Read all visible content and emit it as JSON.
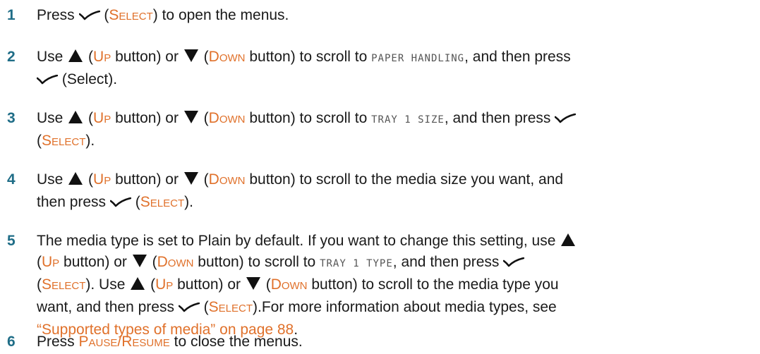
{
  "colors": {
    "step_number": "#1f6d87",
    "accent": "#e0712b"
  },
  "icons": {
    "check": "check-icon",
    "up": "up-arrow-icon",
    "down": "down-arrow-icon"
  },
  "common": {
    "press": "Press",
    "use": "Use",
    "open_paren": "(",
    "close_paren_dot": ").",
    "close_paren": ")",
    "or": "or",
    "button_or": "button) or",
    "button_scroll": "button) to scroll to",
    "and_then_press": ", and then press",
    "select_s": "S",
    "select_rest": "ELECT",
    "up_u": "U",
    "up_rest": "P",
    "down_d": "D",
    "down_rest": "OWN"
  },
  "steps": [
    {
      "number": "1",
      "text_after": "to open the menus."
    },
    {
      "number": "2",
      "lcd": "PAPER HANDLING",
      "tail": "(Select)."
    },
    {
      "number": "3",
      "lcd": "TRAY 1 SIZE"
    },
    {
      "number": "4",
      "text_a": "button) to scroll to the media size you want, and",
      "text_b": "then press"
    },
    {
      "number": "5",
      "text_a": "The media type is set to Plain by default. If you want to change this setting, use",
      "lcd": "TRAY 1 TYPE",
      "text_b": "). Use",
      "text_c": "button) to scroll to the media type you",
      "text_d": "want, and then press",
      "text_e": ").For more information about media types, see",
      "link": "“Supported types of media” on page 88",
      "text_f": "."
    },
    {
      "number": "6",
      "press": "Press",
      "pause_p": "P",
      "pause_rest": "AUSE",
      "slash": "/",
      "resume_r": "R",
      "resume_rest": "ESUME",
      "text_after": "to close the menus."
    }
  ]
}
